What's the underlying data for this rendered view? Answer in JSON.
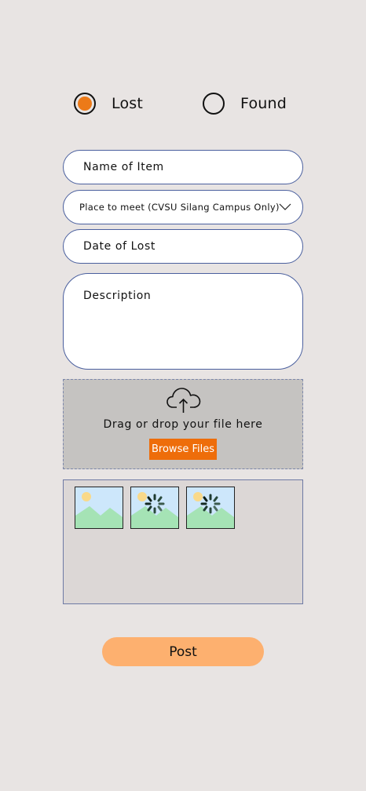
{
  "type_selector": {
    "options": [
      {
        "label": "Lost",
        "selected": true
      },
      {
        "label": "Found",
        "selected": false
      }
    ],
    "accent_color": "#ec7a18"
  },
  "form": {
    "name_placeholder": "Name of Item",
    "place_placeholder": "Place to meet (CVSU Silang Campus Only)",
    "date_placeholder": "Date of Lost",
    "description_placeholder": "Description"
  },
  "upload": {
    "drop_text": "Drag or drop your file here",
    "browse_label": "Browse Files",
    "browse_color": "#ee6d0a",
    "icon": "cloud-upload-icon"
  },
  "gallery": {
    "thumbnails": [
      {
        "icon": "image-placeholder-icon",
        "loading": false
      },
      {
        "icon": "image-placeholder-icon",
        "loading": true
      },
      {
        "icon": "image-placeholder-icon",
        "loading": true
      }
    ]
  },
  "actions": {
    "post_label": "Post",
    "post_color": "#fdb06f"
  }
}
